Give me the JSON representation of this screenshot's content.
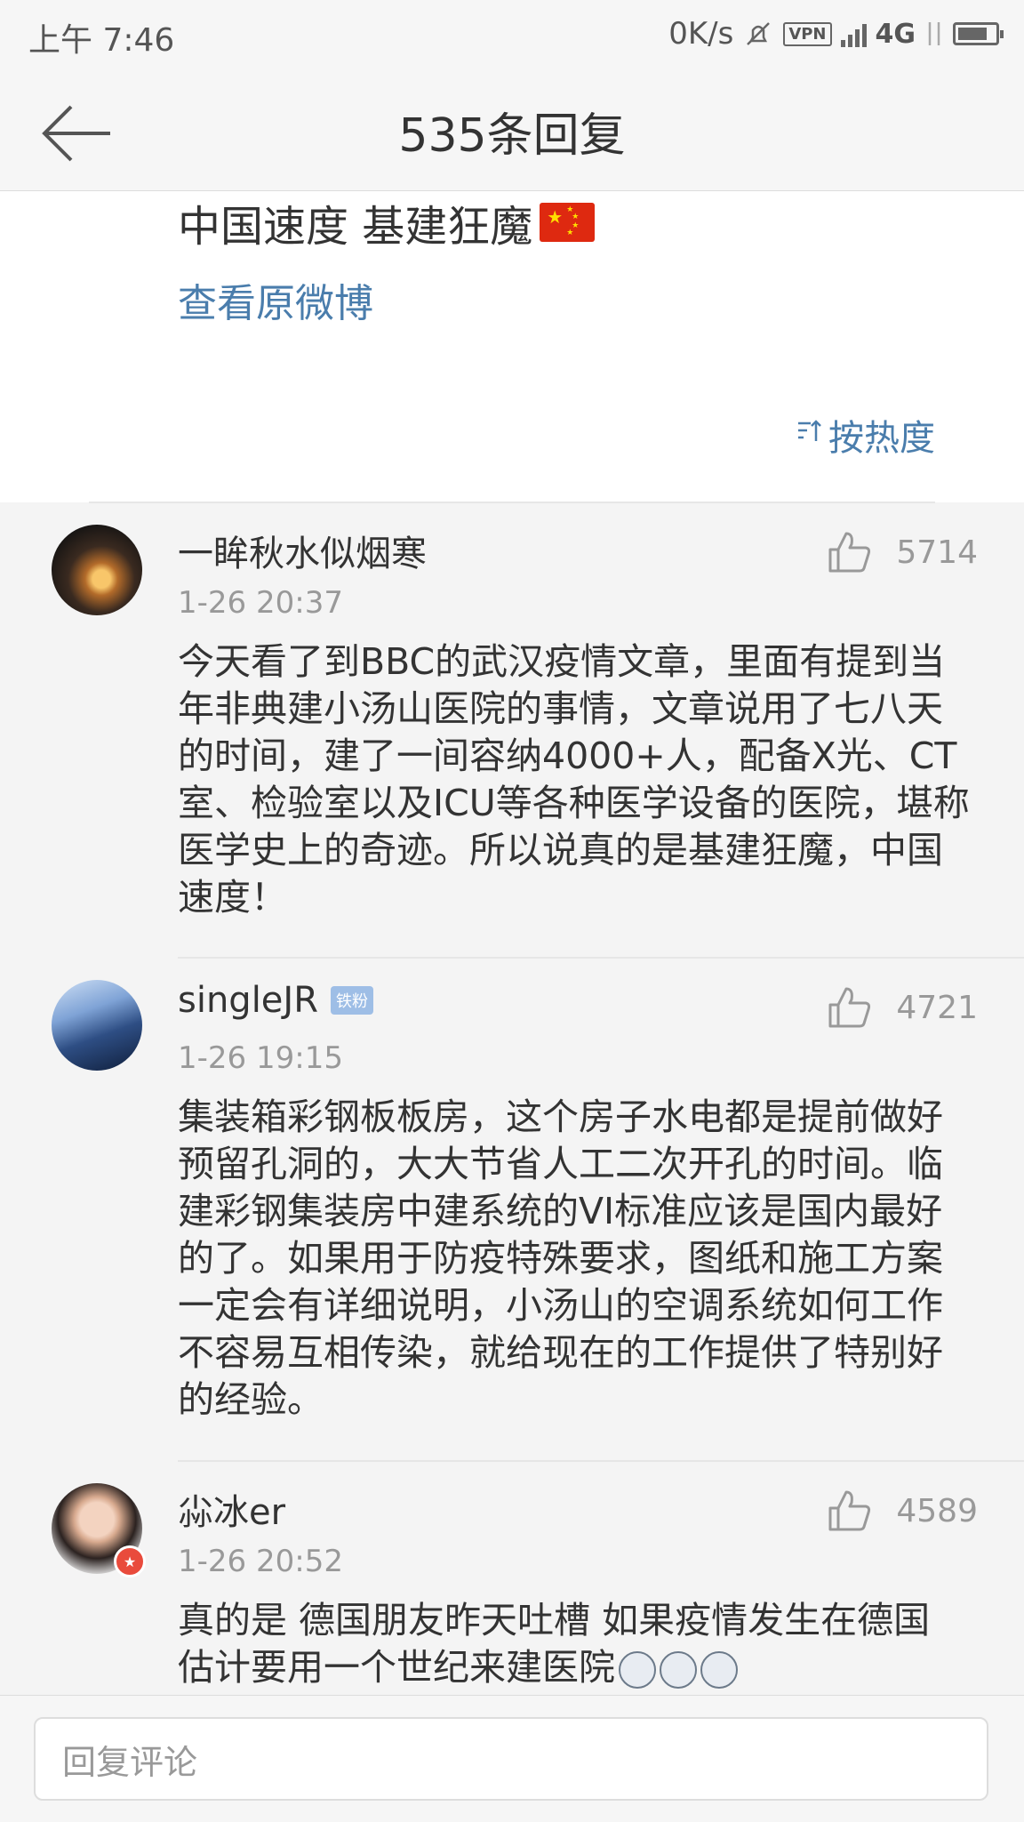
{
  "status_bar": {
    "time": "上午 7:46",
    "speed": "0K/s",
    "vpn": "VPN",
    "network": "4G"
  },
  "nav": {
    "title": "535条回复"
  },
  "post": {
    "text": "中国速度 基建狂魔",
    "view_original": "查看原微博",
    "sort_label": "按热度"
  },
  "comments": [
    {
      "username": "一眸秋水似烟寒",
      "time": "1-26 20:37",
      "likes": "5714",
      "text": "今天看了到BBC的武汉疫情文章，里面有提到当年非典建小汤山医院的事情，文章说用了七八天的时间，建了一间容纳4000+人，配备X光、CT室、检验室以及ICU等各种医学设备的医院，堪称医学史上的奇迹。所以说真的是基建狂魔，中国速度！"
    },
    {
      "username": "singleJR",
      "badge": "铁粉",
      "time": "1-26 19:15",
      "likes": "4721",
      "text": "集装箱彩钢板板房，这个房子水电都是提前做好预留孔洞的，大大节省人工二次开孔的时间。临建彩钢集装房中建系统的VI标准应该是国内最好的了。如果用于防疫特殊要求，图纸和施工方案一定会有详细说明，小汤山的空调系统如何工作不容易互相传染，就给现在的工作提供了特别好的经验。"
    },
    {
      "username": "尛冰er",
      "time": "1-26 20:52",
      "likes": "4589",
      "text": "真的是 德国朋友昨天吐槽 如果疫情发生在德国 估计要用一个世纪来建医院"
    }
  ],
  "reply_input": {
    "placeholder": "回复评论"
  }
}
